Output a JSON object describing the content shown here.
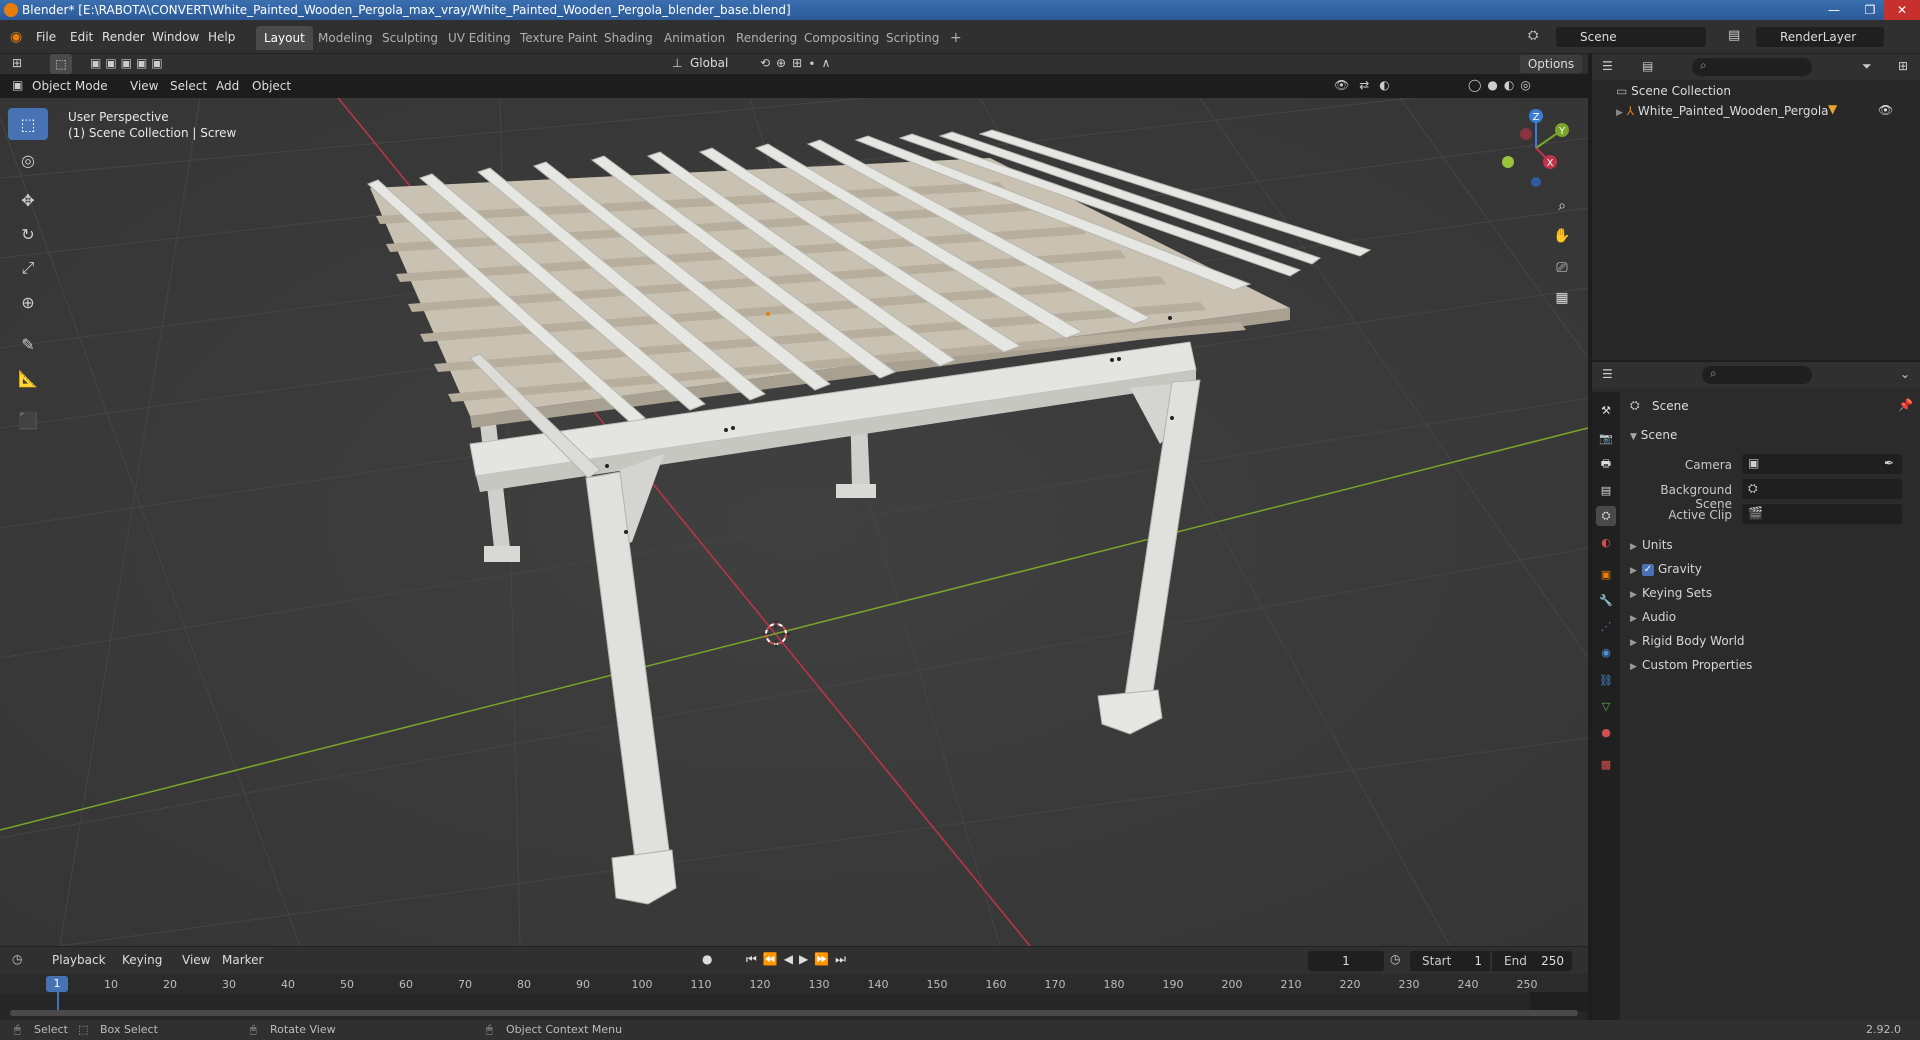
{
  "window": {
    "title": "Blender* [E:\\RABOTA\\CONVERT\\White_Painted_Wooden_Pergola_max_vray/White_Painted_Wooden_Pergola_blender_base.blend]",
    "minimize": "—",
    "maximize": "❐",
    "close": "✕"
  },
  "menu": {
    "file": "File",
    "edit": "Edit",
    "render": "Render",
    "window": "Window",
    "help": "Help"
  },
  "workspaces": [
    "Layout",
    "Modeling",
    "Sculpting",
    "UV Editing",
    "Texture Paint",
    "Shading",
    "Animation",
    "Rendering",
    "Compositing",
    "Scripting"
  ],
  "workspace_add": "+",
  "scene_field": "Scene",
  "renderlayer_field": "RenderLayer",
  "viewport_header": {
    "mode": "Object Mode",
    "view": "View",
    "select": "Select",
    "add": "Add",
    "object": "Object",
    "orientation": "Global",
    "options": "Options"
  },
  "viewport": {
    "perspective": "User Perspective",
    "collection_info": "(1) Scene Collection | Screw",
    "gizmo": {
      "z": "Z",
      "y": "Y",
      "x": "X"
    }
  },
  "outliner": {
    "root": "Scene Collection",
    "item": "White_Painted_Wooden_Pergola"
  },
  "properties": {
    "header": "Scene",
    "section": "Scene",
    "camera_label": "Camera",
    "background_label": "Background Scene",
    "clip_label": "Active Clip",
    "panels": [
      "Units",
      "Gravity",
      "Keying Sets",
      "Audio",
      "Rigid Body World",
      "Custom Properties"
    ]
  },
  "timeline_header": {
    "playback": "Playback",
    "keying": "Keying",
    "view": "View",
    "marker": "Marker",
    "current_frame": "1",
    "start_label": "Start",
    "start": "1",
    "end_label": "End",
    "end": "250"
  },
  "timeline": {
    "current": "1",
    "ticks": [
      "10",
      "20",
      "30",
      "40",
      "50",
      "60",
      "70",
      "80",
      "90",
      "100",
      "110",
      "120",
      "130",
      "140",
      "150",
      "160",
      "170",
      "180",
      "190",
      "200",
      "210",
      "220",
      "230",
      "240",
      "250"
    ]
  },
  "statusbar": {
    "select": "Select",
    "box_select": "Box Select",
    "rotate": "Rotate View",
    "context_menu": "Object Context Menu",
    "version": "2.92.0"
  },
  "colors": {
    "accent": "#4772b3",
    "x_axis": "#c2334a",
    "y_axis": "#7aa52a",
    "pergola": "#dcdcd8",
    "roof": "#c9c1b1"
  }
}
